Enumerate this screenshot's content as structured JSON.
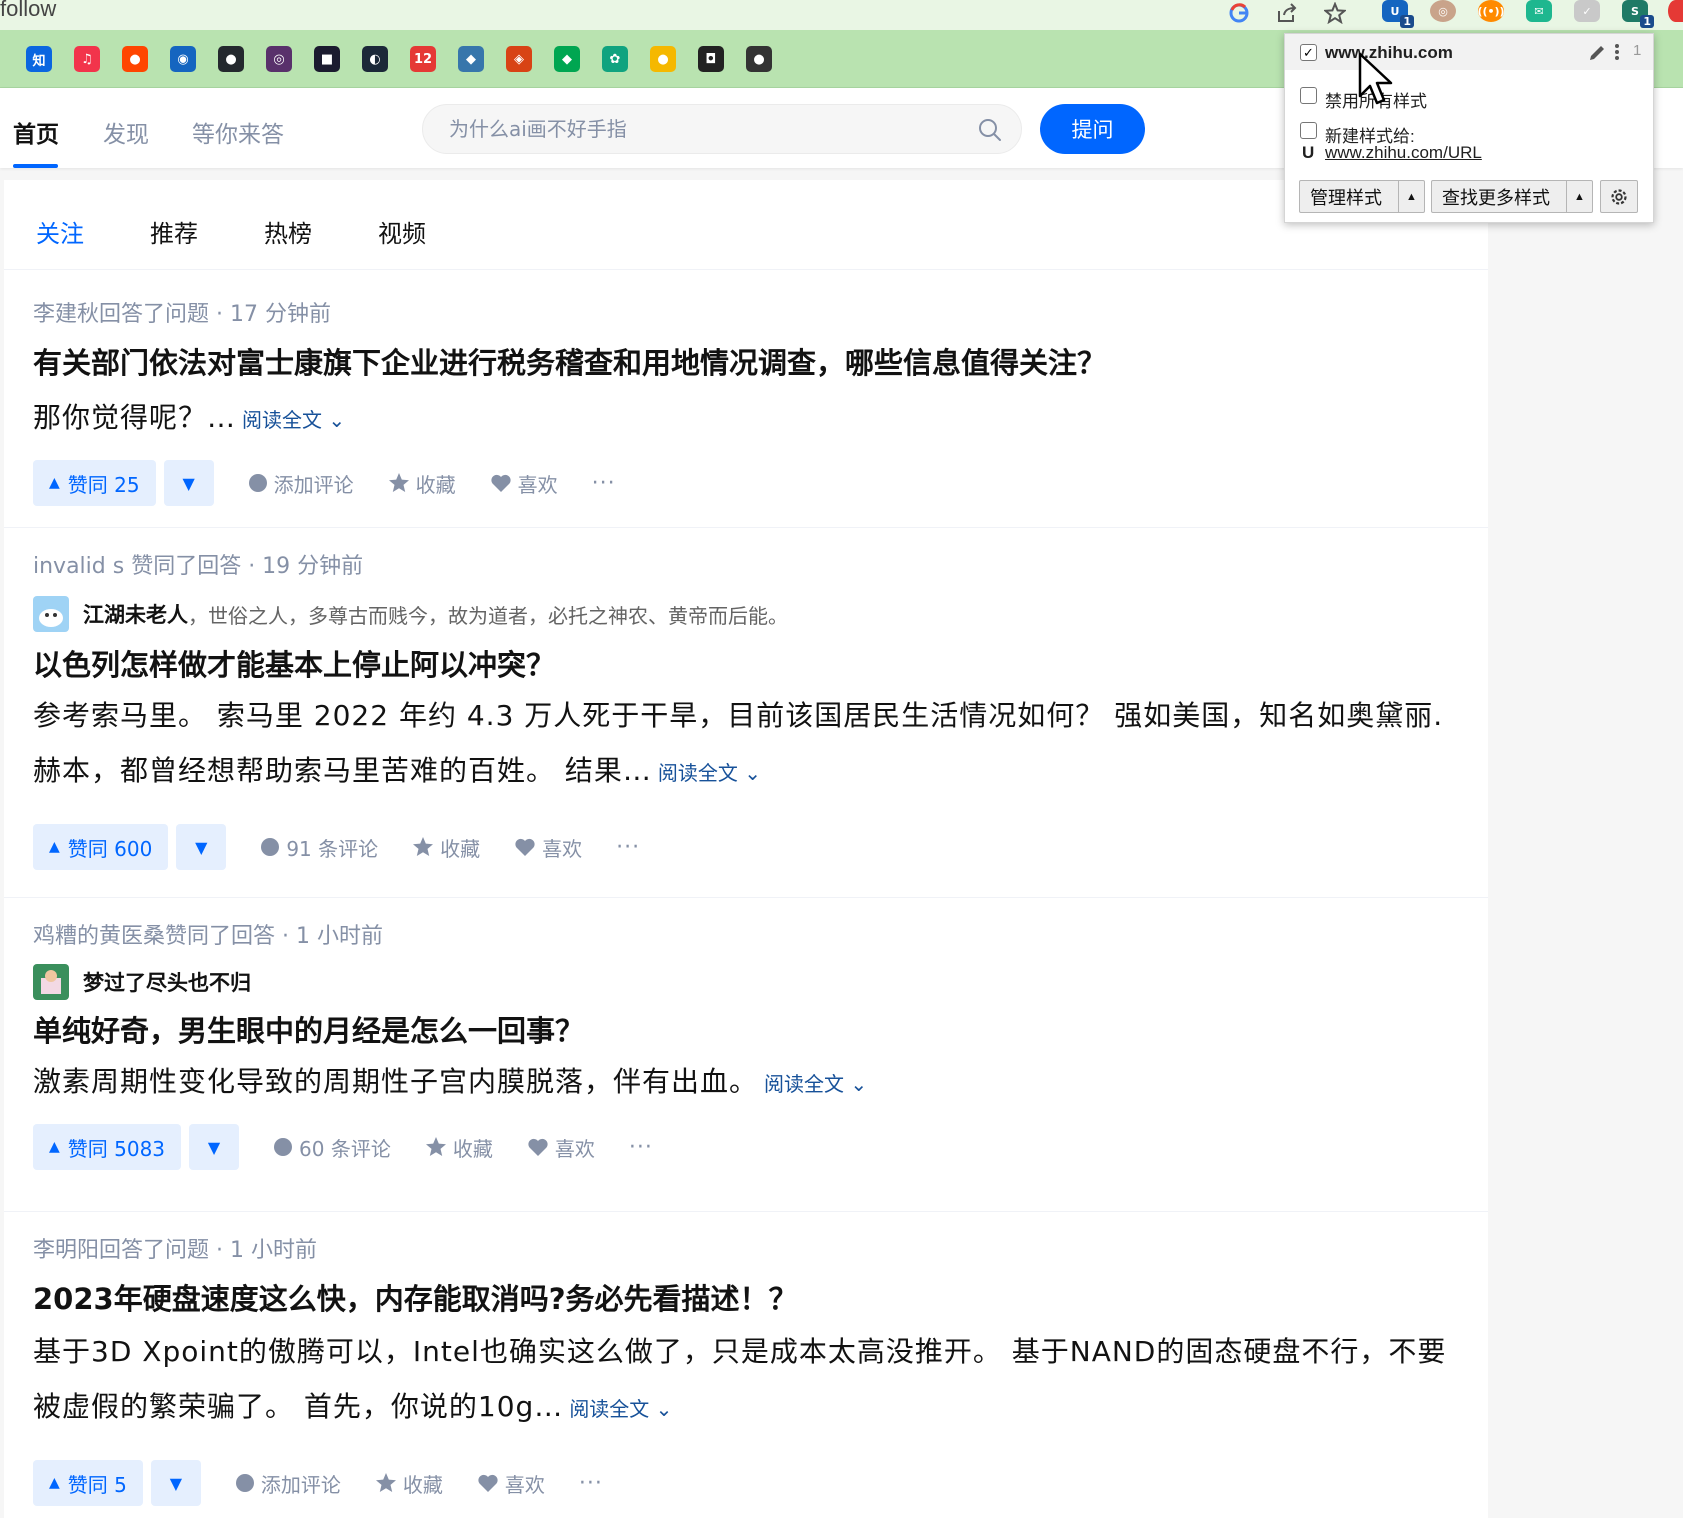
{
  "browser": {
    "top_left_text": "follow",
    "extension_badges": [
      "1",
      "1"
    ],
    "bookmark_icons": [
      {
        "name": "zhihu",
        "glyph": "知",
        "color": "#0a66e0"
      },
      {
        "name": "music",
        "glyph": "♫",
        "color": "#f2344b"
      },
      {
        "name": "reddit",
        "glyph": "●",
        "color": "#ff4500"
      },
      {
        "name": "circle-app",
        "glyph": "◉",
        "color": "#1565c0"
      },
      {
        "name": "github",
        "glyph": "●",
        "color": "#24292e"
      },
      {
        "name": "tor",
        "glyph": "◎",
        "color": "#59316b"
      },
      {
        "name": "dark-app",
        "glyph": "■",
        "color": "#1b1b2f"
      },
      {
        "name": "steam",
        "glyph": "◐",
        "color": "#1b2838"
      },
      {
        "name": "calendar",
        "glyph": "12",
        "color": "#e53935"
      },
      {
        "name": "python",
        "glyph": "◆",
        "color": "#3776ab"
      },
      {
        "name": "game",
        "glyph": "◈",
        "color": "#d84315"
      },
      {
        "name": "leaf",
        "glyph": "◆",
        "color": "#00a651"
      },
      {
        "name": "openai",
        "glyph": "✿",
        "color": "#10a37f"
      },
      {
        "name": "emoji",
        "glyph": "●",
        "color": "#f5b800"
      },
      {
        "name": "robot",
        "glyph": "◘",
        "color": "#222222"
      },
      {
        "name": "cat",
        "glyph": "●",
        "color": "#333333"
      }
    ]
  },
  "header": {
    "tabs": [
      "首页",
      "发现",
      "等你来答"
    ],
    "search_placeholder": "为什么ai画不好手指",
    "ask_label": "提问"
  },
  "feed": {
    "tabs": [
      "关注",
      "推荐",
      "热榜",
      "视频"
    ],
    "items": [
      {
        "meta": "李建秋回答了问题 · 17 分钟前",
        "title": "有关部门依法对富士康旗下企业进行税务稽查和用地情况调查，哪些信息值得关注？",
        "excerpt": "那你觉得呢？…",
        "read_more": "阅读全文",
        "vote": "赞同 25",
        "comment": "添加评论",
        "collect": "收藏",
        "like": "喜欢",
        "more": "···"
      },
      {
        "meta": "invalid s 赞同了回答 · 19 分钟前",
        "author_name": "江湖未老人",
        "author_bio": "，世俗之人，多尊古而贱今，故为道者，必托之神农、黄帝而后能。",
        "title": "以色列怎样做才能基本上停止阿以冲突？",
        "excerpt": "参考索马里。 索马里 2022 年约 4.3 万人死于干旱，目前该国居民生活情况如何？ 强如美国，知名如奥黛丽.赫本，都曾经想帮助索马里苦难的百姓。 结果…",
        "read_more": "阅读全文",
        "vote": "赞同 600",
        "comment": "91 条评论",
        "collect": "收藏",
        "like": "喜欢",
        "more": "···"
      },
      {
        "meta": "鸡糟的黄医桑赞同了回答 · 1 小时前",
        "author_name": "梦过了尽头也不归",
        "title": "单纯好奇，男生眼中的月经是怎么一回事？",
        "excerpt": "激素周期性变化导致的周期性子宫内膜脱落，伴有出血。",
        "read_more": "阅读全文",
        "vote": "赞同 5083",
        "comment": "60 条评论",
        "collect": "收藏",
        "like": "喜欢",
        "more": "···"
      },
      {
        "meta": "李明阳回答了问题 · 1 小时前",
        "title": "2023年硬盘速度这么快，内存能取消吗?务必先看描述！？",
        "excerpt": "基于3D Xpoint的傲腾可以，Intel也确实这么做了，只是成本太高没推开。 基于NAND的固态硬盘不行，不要被虚假的繁荣骗了。 首先，你说的10g…",
        "read_more": "阅读全文",
        "vote": "赞同 5",
        "comment": "添加评论",
        "collect": "收藏",
        "like": "喜欢",
        "more": "···"
      }
    ]
  },
  "stylus": {
    "site": "www.zhihu.com",
    "count": "1",
    "disable_label": "禁用所有样式",
    "new_style_label": "新建样式给:",
    "new_style_url": "www.zhihu.com/URL",
    "url_prefix": "U",
    "manage_label": "管理样式",
    "find_label": "查找更多样式"
  },
  "colors": {
    "accent": "#0066ff",
    "vote_bg": "#e5effe",
    "meta": "#8590a6",
    "link": "#175199",
    "bookmark_bar": "#b9e3b0"
  }
}
